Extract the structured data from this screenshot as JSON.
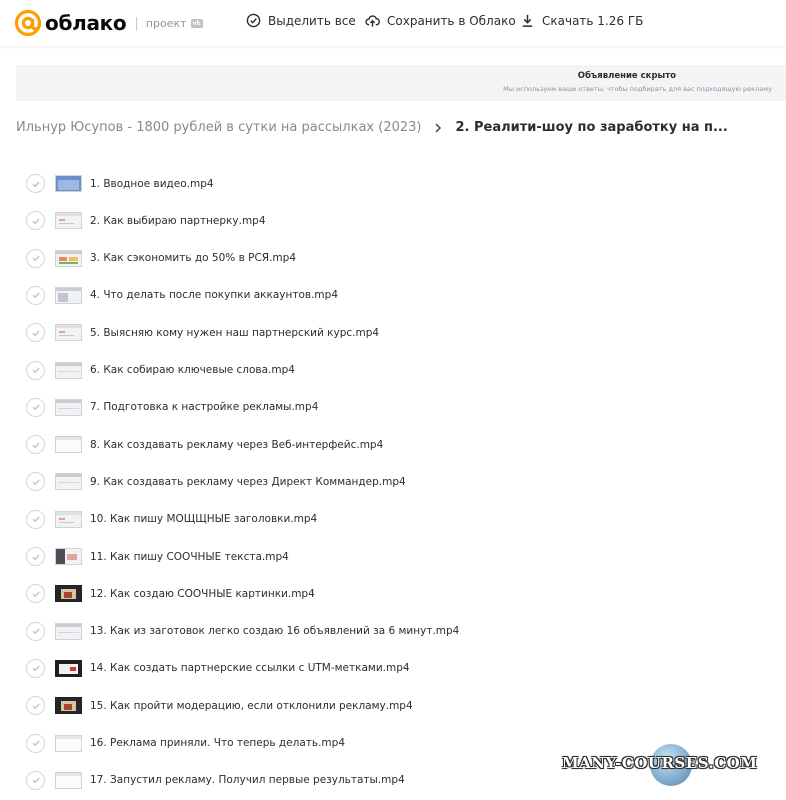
{
  "header": {
    "logo_text": "облако",
    "project_label": "проект",
    "vk_badge": "vk",
    "select_all": "Выделить все",
    "save_to_cloud": "Сохранить в Облако",
    "download": "Скачать 1.26 ГБ"
  },
  "ad": {
    "title": "Объявление скрыто",
    "subtitle": "Мы используем ваши ответы, чтобы подбирать для вас подходящую рекламу"
  },
  "breadcrumb": {
    "parent": "Ильнур Юсупов - 1800 рублей в сутки на рассылках (2023)",
    "current": "2. Реалити-шоу по заработку на п..."
  },
  "files": [
    {
      "name": "1. Вводное видео.mp4",
      "thumb": "blue"
    },
    {
      "name": "2. Как выбираю партнерку.mp4",
      "thumb": "light"
    },
    {
      "name": "3. Как сэкономить до 50% в РСЯ.mp4",
      "thumb": "colorful"
    },
    {
      "name": "4. Что делать после покупки аккаунтов.mp4",
      "thumb": "grey"
    },
    {
      "name": "5. Выясняю кому нужен наш партнерский курс.mp4",
      "thumb": "light"
    },
    {
      "name": "6. Как собираю ключевые слова.mp4",
      "thumb": "plain"
    },
    {
      "name": "7. Подготовка к настройке рекламы.mp4",
      "thumb": "plain"
    },
    {
      "name": "8. Как создавать рекламу через Веб-интерфейс.mp4",
      "thumb": "white"
    },
    {
      "name": "9. Как создавать рекламу через Директ Коммандер.mp4",
      "thumb": "plain"
    },
    {
      "name": "10. Как пишу МОЩЩНЫЕ заголовки.mp4",
      "thumb": "light"
    },
    {
      "name": "11. Как пишу СООЧНЫЕ текста.mp4",
      "thumb": "dark-left"
    },
    {
      "name": "12. Как создаю СООЧНЫЕ картинки.mp4",
      "thumb": "dark"
    },
    {
      "name": "13. Как из заготовок легко создаю 16 объявлений за 6 минут.mp4",
      "thumb": "plain"
    },
    {
      "name": "14. Как создать партнерские ссылки с UTM-метками.mp4",
      "thumb": "dark-red"
    },
    {
      "name": "15. Как пройти модерацию, если отклонили рекламу.mp4",
      "thumb": "dark"
    },
    {
      "name": "16. Реклама приняли. Что теперь делать.mp4",
      "thumb": "white"
    },
    {
      "name": "17. Запустил рекламу. Получил первые результаты.mp4",
      "thumb": "white"
    }
  ],
  "watermark": "MANY-COURSES.COM",
  "colors": {
    "accent": "#ff9e00",
    "text": "#2c2d2e",
    "muted": "#87898f"
  }
}
